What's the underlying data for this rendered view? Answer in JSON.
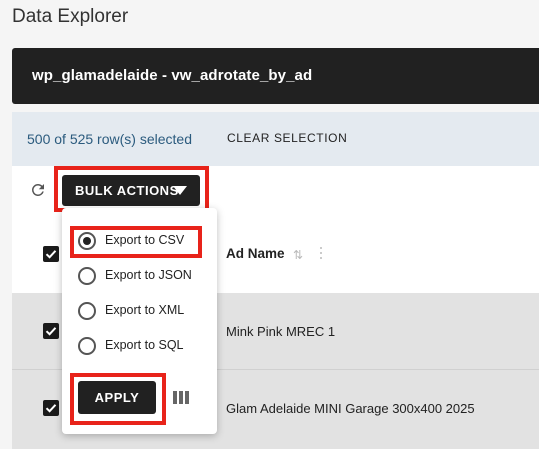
{
  "page": {
    "title": "Data Explorer"
  },
  "header": {
    "title": "wp_glamadelaide - vw_adrotate_by_ad"
  },
  "selection": {
    "count_text": "500 of 525 row(s) selected",
    "clear_label": "CLEAR SELECTION"
  },
  "toolbar": {
    "refresh_icon": "refresh-icon",
    "bulk_actions_label": "BULK ACTIONS",
    "bulk_caret_icon": "caret-down-icon"
  },
  "dropdown": {
    "options": [
      {
        "label": "Export to CSV",
        "checked": true
      },
      {
        "label": "Export to JSON",
        "checked": false
      },
      {
        "label": "Export to XML",
        "checked": false
      },
      {
        "label": "Export to SQL",
        "checked": false
      }
    ],
    "apply_label": "APPLY",
    "columns_icon": "columns-icon"
  },
  "table": {
    "column_header": "Ad Name",
    "rows": [
      {
        "ad_name": "Mink Pink MREC 1",
        "selected": true
      },
      {
        "ad_name": "Glam Adelaide MINI Garage 300x400 2025",
        "selected": true
      }
    ]
  },
  "colors": {
    "dark": "#212121",
    "highlight": "#e8231a",
    "selection_bg": "#e4eaf0",
    "link": "#2b5b7e"
  }
}
